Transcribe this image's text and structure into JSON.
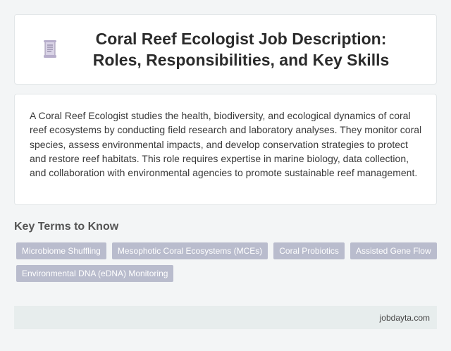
{
  "header": {
    "icon": "document-icon",
    "title": "Coral Reef Ecologist Job Description: Roles, Responsibilities, and Key Skills"
  },
  "description": {
    "text": "A Coral Reef Ecologist studies the health, biodiversity, and ecological dynamics of coral reef ecosystems by conducting field research and laboratory analyses. They monitor coral species, assess environmental impacts, and develop conservation strategies to protect and restore reef habitats. This role requires expertise in marine biology, data collection, and collaboration with environmental agencies to promote sustainable reef management."
  },
  "key_terms": {
    "heading": "Key Terms to Know",
    "tags": [
      "Microbiome Shuffling",
      "Mesophotic Coral Ecosystems (MCEs)",
      "Coral Probiotics",
      "Assisted Gene Flow",
      "Environmental DNA (eDNA) Monitoring"
    ]
  },
  "footer": {
    "site": "jobdayta.com"
  },
  "colors": {
    "tag_bg": "#b9bccd",
    "page_bg": "#f3f5f6",
    "footer_bg": "#e7eded"
  }
}
